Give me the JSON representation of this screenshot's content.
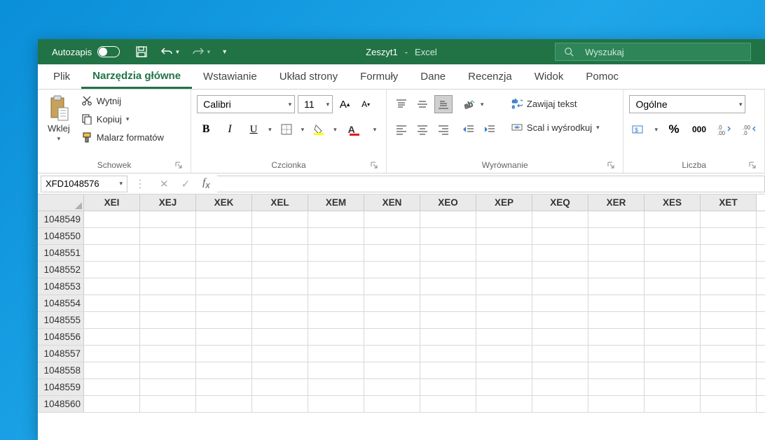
{
  "titlebar": {
    "autosave": "Autozapis",
    "doc": "Zeszyt1",
    "app": "Excel",
    "search_placeholder": "Wyszukaj"
  },
  "tabs": {
    "file": "Plik",
    "home": "Narzędzia główne",
    "insert": "Wstawianie",
    "layout": "Układ strony",
    "formulas": "Formuły",
    "data": "Dane",
    "review": "Recenzja",
    "view": "Widok",
    "help": "Pomoc"
  },
  "ribbon": {
    "clipboard": {
      "paste": "Wklej",
      "cut": "Wytnij",
      "copy": "Kopiuj",
      "painter": "Malarz formatów",
      "label": "Schowek"
    },
    "font": {
      "name": "Calibri",
      "size": "11",
      "label": "Czcionka"
    },
    "align": {
      "wrap": "Zawijaj tekst",
      "merge": "Scal i wyśrodkuj",
      "label": "Wyrównanie"
    },
    "number": {
      "format": "Ogólne",
      "thousands": "000",
      "label": "Liczba"
    }
  },
  "formula_bar": {
    "name": "XFD1048576"
  },
  "grid": {
    "columns": [
      "XEI",
      "XEJ",
      "XEK",
      "XEL",
      "XEM",
      "XEN",
      "XEO",
      "XEP",
      "XEQ",
      "XER",
      "XES",
      "XET"
    ],
    "rows": [
      "1048549",
      "1048550",
      "1048551",
      "1048552",
      "1048553",
      "1048554",
      "1048555",
      "1048556",
      "1048557",
      "1048558",
      "1048559",
      "1048560"
    ]
  }
}
